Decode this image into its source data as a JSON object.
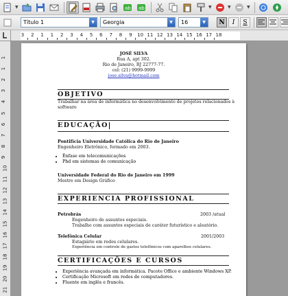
{
  "toolbar2": {
    "style": "Título 1",
    "font": "Georgia",
    "size": "16",
    "bold": "N",
    "italic": "I",
    "underline": "S"
  },
  "ruler": {
    "h_ticks": [
      "3",
      "2",
      "1",
      "1",
      "2",
      "3",
      "4",
      "5",
      "6",
      "7",
      "8",
      "9",
      "10",
      "11",
      "12",
      "13",
      "14",
      "15",
      "16",
      "17",
      "18"
    ],
    "v_ticks": [
      "1",
      "1",
      "2",
      "3",
      "4",
      "5",
      "6",
      "7",
      "8",
      "9",
      "10",
      "11",
      "12",
      "13",
      "14",
      "15",
      "16",
      "17",
      "18",
      "19",
      "20",
      "21"
    ]
  },
  "resume": {
    "name": "JOSÉ SILVA",
    "address1": "Rua A, apt 302.",
    "address2": "Rio de Janeiro, RJ 22777-77.",
    "phone": "cel: (21) 9999-9999",
    "email": "jose.silva@hotmail.com",
    "objective_title": "OBJETIVO",
    "objective_text": "Trabalhar na área de informática no desenvolvimento de projetos relacionados à software",
    "education_title": "EDUCAÇÃO",
    "edu1_school": "Pontifícia Universidade Católica do Rio de Janeiro",
    "edu1_degree": "Engenheiro Eletrônico, formado em 2003.",
    "edu1_bullets": [
      "Ênfase em telecomunicações",
      "Phd em sistemas de comunicação"
    ],
    "edu2_school": "Universidade Federal do Rio de Janeiro em 1999",
    "edu2_degree": "Mestre em Design Gráfico",
    "experience_title": "EXPERIENCIA PROFISSIONAL",
    "exp1_company": "Petrobrás",
    "exp1_period": "2003 /atual",
    "exp1_line1": "Engenheiro de assuntos especiais.",
    "exp1_line2": "Trabalho com assuntos especiais de caráter futurístico e aleatório.",
    "exp2_company": "Telefônica Celular",
    "exp2_period": "2001/2003",
    "exp2_line1": "Estagiário em redes celulares.",
    "exp2_line2": "Experiência em controle de gastos telefônicos com aparelhos celulares.",
    "cert_title": "CERTIFICAÇÕES E CURSOS",
    "cert_bullets": [
      "Experiência avançada em informática. Pacote Office e ambiente Windows XP.",
      "Certificação Microsoft em redes de computadores.",
      "Fluente em inglês e francês."
    ]
  }
}
